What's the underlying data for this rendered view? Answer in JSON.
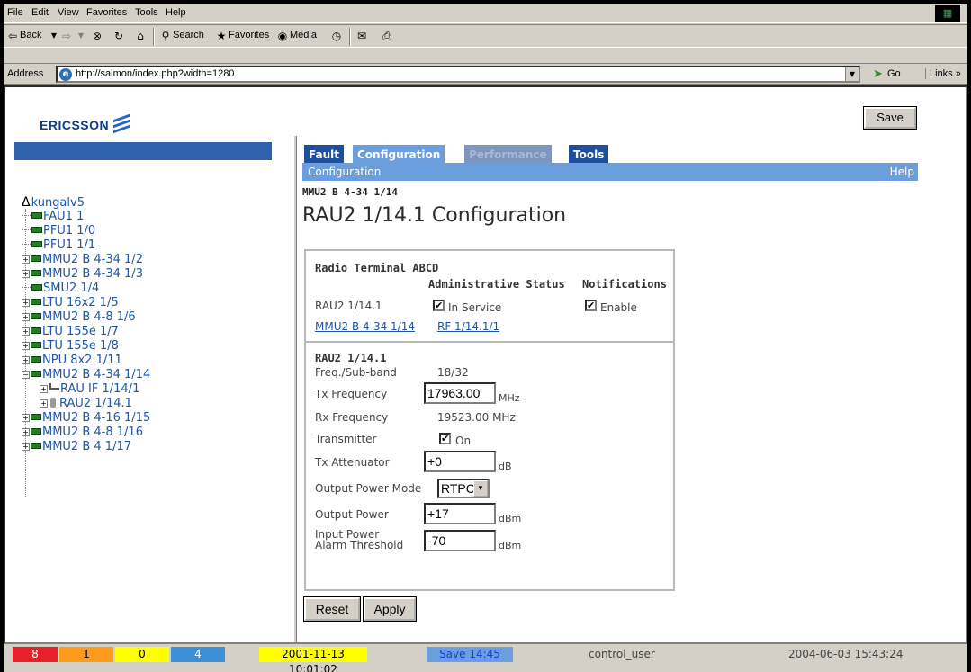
{
  "menu": {
    "items": [
      "File",
      "Edit",
      "View",
      "Favorites",
      "Tools",
      "Help"
    ]
  },
  "toolbar": {
    "back": "Back",
    "search": "Search",
    "favorites": "Favorites",
    "media": "Media"
  },
  "address": {
    "label": "Address",
    "url": "http://salmon/index.php?width=1280",
    "go": "Go",
    "links": "Links »"
  },
  "header": {
    "logo": "ERICSSON",
    "save": "Save"
  },
  "tree": {
    "root": "kungalv5",
    "items": [
      "FAU1 1",
      "PFU1 1/0",
      "PFU1 1/1",
      "MMU2 B 4-34 1/2",
      "MMU2 B 4-34 1/3",
      "SMU2 1/4",
      "LTU 16x2 1/5",
      "MMU2 B 4-8 1/6",
      "LTU 155e 1/7",
      "LTU 155e 1/8",
      "NPU 8x2 1/11",
      "MMU2 B 4-34 1/14",
      "RAU IF 1/14/1",
      "RAU2 1/14.1",
      "MMU2 B 4-16 1/15",
      "MMU2 B 4-8 1/16",
      "MMU2 B 4 1/17"
    ]
  },
  "tabs": [
    "Fault",
    "Configuration",
    "Performance",
    "Tools"
  ],
  "subbar": {
    "label": "Configuration",
    "help": "Help"
  },
  "breadcrumb": "MMU2 B 4-34 1/14",
  "page_title": "RAU2 1/14.1 Configuration",
  "panel1": {
    "title": "Radio Terminal ABCD",
    "col_admin": "Administrative Status",
    "col_notif": "Notifications",
    "row_label": "RAU2 1/14.1",
    "admin_label": "In Service",
    "notif_label": "Enable",
    "link1": "MMU2 B 4-34 1/14",
    "link2": "RF 1/14.1/1"
  },
  "panel2": {
    "title": "RAU2 1/14.1",
    "freq_sub_label": "Freq./Sub-band",
    "freq_sub_value": "18/32",
    "tx_freq_label": "Tx Frequency",
    "tx_freq_value": "17963.00",
    "tx_freq_unit": "MHz",
    "rx_freq_label": "Rx Frequency",
    "rx_freq_value": "19523.00 MHz",
    "transmitter_label": "Transmitter",
    "transmitter_on": "On",
    "tx_atten_label": "Tx Attenuator",
    "tx_atten_value": "+0",
    "tx_atten_unit": "dB",
    "opm_label": "Output Power Mode",
    "opm_value": "RTPC",
    "op_label": "Output Power",
    "op_value": "+17",
    "op_unit": "dBm",
    "ipat_label1": "Input Power",
    "ipat_label2": "Alarm Threshold",
    "ipat_value": "-70",
    "ipat_unit": "dBm"
  },
  "buttons": {
    "reset": "Reset",
    "apply": "Apply"
  },
  "status": {
    "c1": "8",
    "c2": "1",
    "c3": "0",
    "c4": "4",
    "datetime1": "2001-11-13 10:01:02",
    "save_link": "Save 14:45",
    "user": "control_user",
    "datetime2": "2004-06-03 15:43:24"
  },
  "colors": {
    "critical": "#e8202a",
    "major": "#ff9b1a",
    "minor": "#ffff00",
    "warning": "#3d8fd8",
    "tab_dark": "#1f4f9a",
    "tab_active": "#6b9edc"
  }
}
